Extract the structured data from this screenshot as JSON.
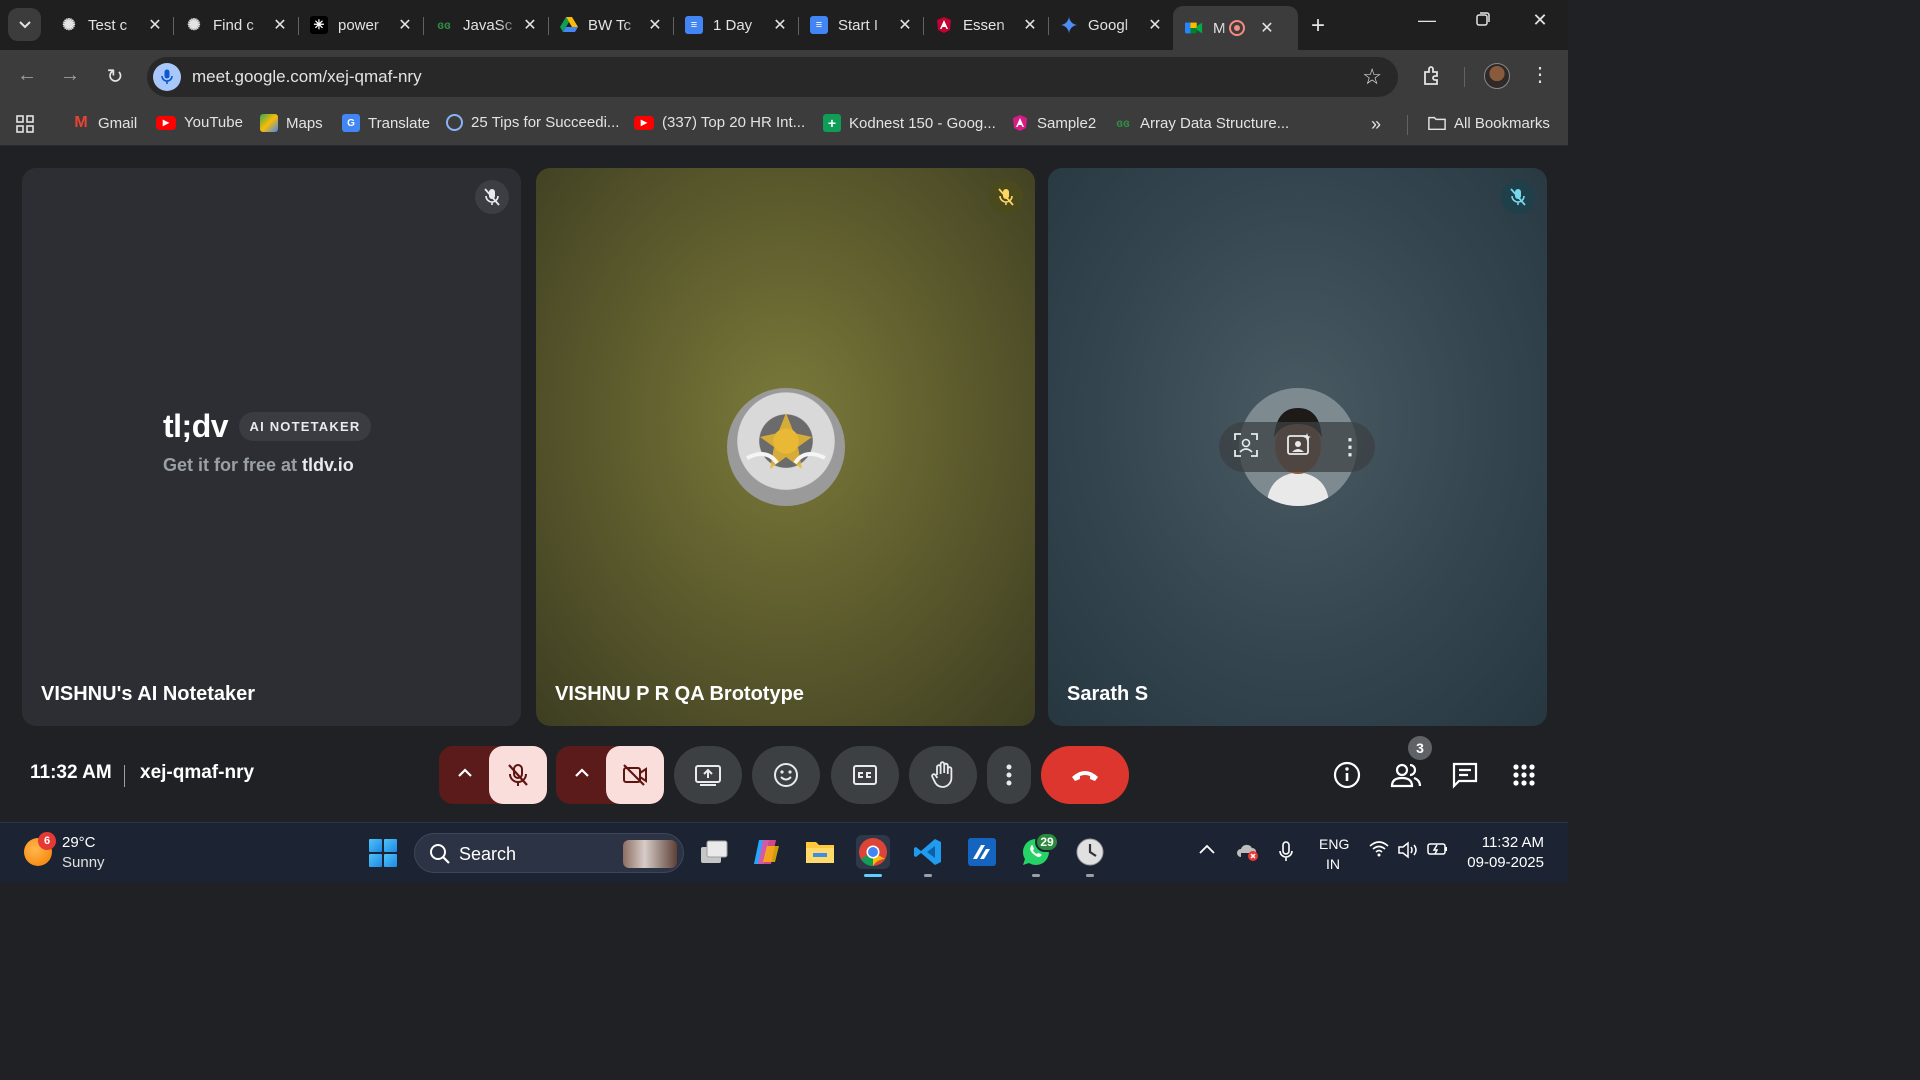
{
  "browser": {
    "tabs": [
      {
        "title": "Test c",
        "icon": "chatgpt-icon"
      },
      {
        "title": "Find c",
        "icon": "chatgpt-icon"
      },
      {
        "title": "power",
        "icon": "perplexity-icon"
      },
      {
        "title": "JavaSc",
        "icon": "gfg-icon"
      },
      {
        "title": "BW Tc",
        "icon": "google-drive-icon"
      },
      {
        "title": "1 Day",
        "icon": "google-docs-icon"
      },
      {
        "title": "Start I",
        "icon": "google-docs-icon"
      },
      {
        "title": "Essen",
        "icon": "angular-icon"
      },
      {
        "title": "Googl",
        "icon": "gemini-icon"
      },
      {
        "title": "M",
        "icon": "google-meet-icon"
      }
    ],
    "url": "meet.google.com/xej-qmaf-nry"
  },
  "bookmarks": [
    {
      "label": "Gmail",
      "icon": "gmail-icon"
    },
    {
      "label": "YouTube",
      "icon": "youtube-icon"
    },
    {
      "label": "Maps",
      "icon": "maps-icon"
    },
    {
      "label": "Translate",
      "icon": "translate-icon"
    },
    {
      "label": "25 Tips for Succeedi...",
      "icon": "globe-icon"
    },
    {
      "label": "(337) Top 20 HR Int...",
      "icon": "youtube-icon"
    },
    {
      "label": "Kodnest 150 - Goog...",
      "icon": "google-sheets-icon"
    },
    {
      "label": "Sample2",
      "icon": "angular-icon"
    },
    {
      "label": "Array Data Structure...",
      "icon": "gfg-icon"
    }
  ],
  "all_bookmarks": "All Bookmarks",
  "meet": {
    "participants": [
      {
        "name": "VISHNU's AI Notetaker",
        "muted": true
      },
      {
        "name": "VISHNU P R QA Brototype",
        "muted": true
      },
      {
        "name": "Sarath S",
        "muted": true
      }
    ],
    "tldv": {
      "logo": "tl;dv",
      "pill": "AI NOTETAKER",
      "sub_prefix": "Get it for free at",
      "sub_link": "tldv.io"
    },
    "time": "11:32 AM",
    "meeting_code": "xej-qmaf-nry",
    "people_count": "3"
  },
  "taskbar": {
    "weather_badge": "6",
    "temperature": "29°C",
    "condition": "Sunny",
    "search_label": "Search",
    "whatsapp_badge": "29",
    "lang_top": "ENG",
    "lang_bottom": "IN",
    "time": "11:32 AM",
    "date": "09-09-2025"
  },
  "colors": {
    "end_call": "#dc362e",
    "muted_control": "#f9dedc",
    "accent_blue": "#a8c7fa"
  }
}
